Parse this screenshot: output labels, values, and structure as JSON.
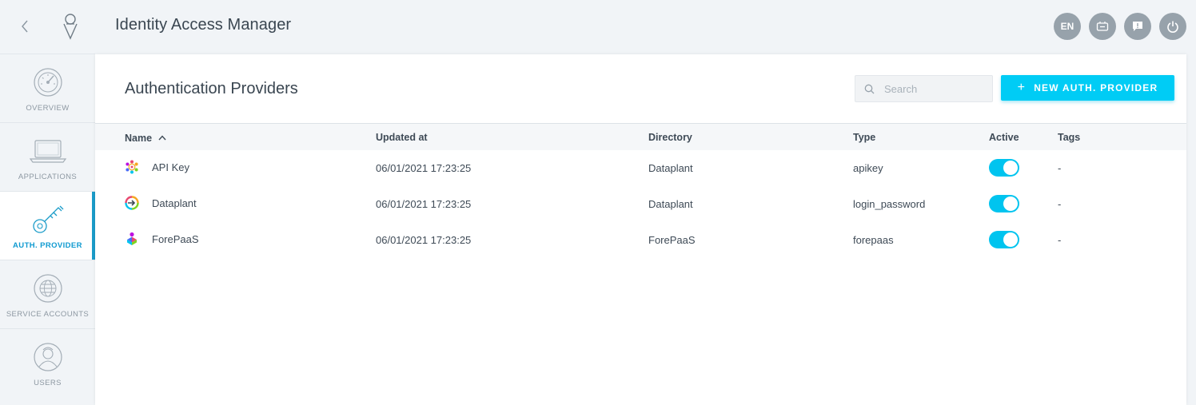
{
  "app": {
    "title": "Identity Access Manager"
  },
  "top_actions": {
    "language": "EN"
  },
  "sidebar": {
    "items": [
      {
        "label": "OVERVIEW",
        "icon": "gauge-icon"
      },
      {
        "label": "APPLICATIONS",
        "icon": "laptop-icon"
      },
      {
        "label": "AUTH. PROVIDER",
        "icon": "key-icon",
        "active": true
      },
      {
        "label": "SERVICE ACCOUNTS",
        "icon": "globe-gear-icon"
      },
      {
        "label": "USERS",
        "icon": "user-icon"
      }
    ]
  },
  "main": {
    "title": "Authentication Providers",
    "search": {
      "placeholder": "Search",
      "value": ""
    },
    "new_button": {
      "label": "NEW AUTH. PROVIDER"
    }
  },
  "table": {
    "columns": {
      "name": "Name",
      "updated": "Updated at",
      "directory": "Directory",
      "type": "Type",
      "active": "Active",
      "tags": "Tags"
    },
    "sort": {
      "column": "name",
      "direction": "ascending"
    },
    "rows": [
      {
        "name": "API Key",
        "updated": "06/01/2021 17:23:25",
        "directory": "Dataplant",
        "type": "apikey",
        "active": true,
        "tags": "-",
        "icon": "api-key-gear-icon"
      },
      {
        "name": "Dataplant",
        "updated": "06/01/2021 17:23:25",
        "directory": "Dataplant",
        "type": "login_password",
        "active": true,
        "tags": "-",
        "icon": "dataplant-logo-icon"
      },
      {
        "name": "ForePaaS",
        "updated": "06/01/2021 17:23:25",
        "directory": "ForePaaS",
        "type": "forepaas",
        "active": true,
        "tags": "-",
        "icon": "forepaas-logo-icon"
      }
    ]
  },
  "colors": {
    "accent": "#00ccf5",
    "toggle_on": "#00c4ef",
    "active_nav": "#0f9ad0",
    "icon_grey": "#97a2ab"
  }
}
